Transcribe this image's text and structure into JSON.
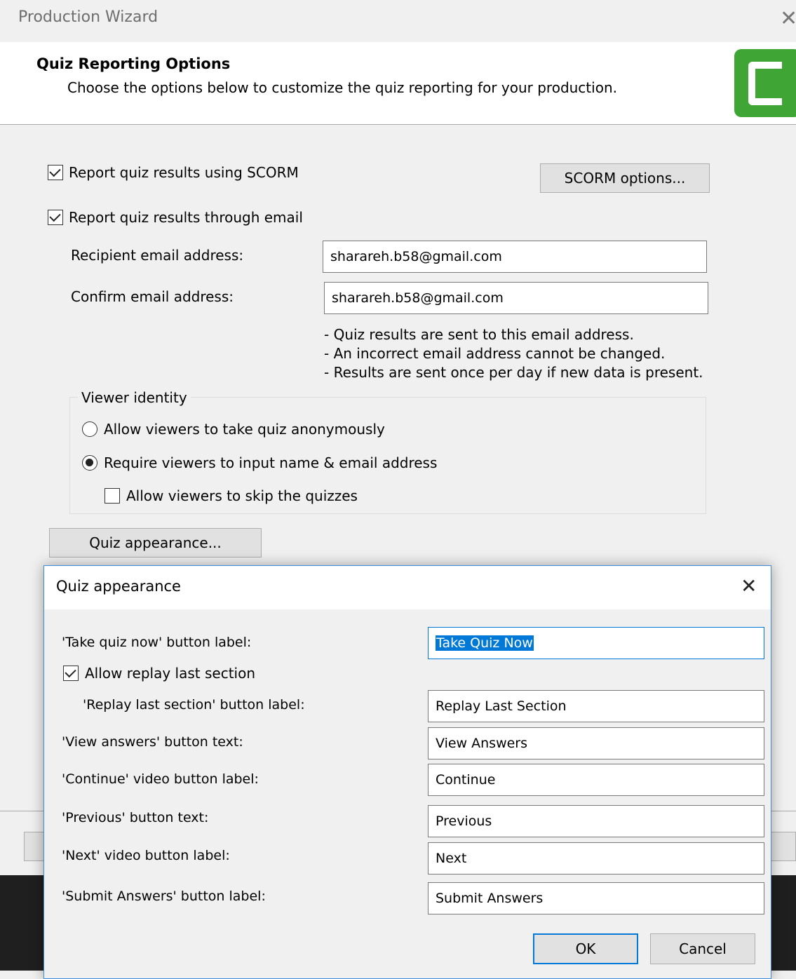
{
  "window": {
    "title": "Production Wizard",
    "close_glyph": "✕"
  },
  "header": {
    "title": "Quiz Reporting Options",
    "subtitle": "Choose the options below to customize the quiz reporting for your production.",
    "logo_icon": "camtasia-logo-icon",
    "logo_color": "#3fa535"
  },
  "reporting": {
    "scorm_checkbox_label": "Report quiz results using SCORM",
    "scorm_checked": true,
    "scorm_options_button": "SCORM options...",
    "email_checkbox_label": "Report quiz results through email",
    "email_checked": true,
    "recipient_label": "Recipient email address:",
    "recipient_value": "sharareh.b58@gmail.com",
    "confirm_label": "Confirm email address:",
    "confirm_value": "sharareh.b58@gmail.com",
    "notes": [
      "- Quiz results are sent to this email address.",
      "- An incorrect email address cannot be changed.",
      "- Results are sent once per day if new data is present."
    ]
  },
  "viewer_identity": {
    "legend": "Viewer identity",
    "anonymous_label": "Allow viewers to take quiz anonymously",
    "anonymous_selected": false,
    "require_label": "Require viewers to input name & email address",
    "require_selected": true,
    "skip_label": "Allow viewers to skip the quizzes",
    "skip_checked": false
  },
  "quiz_appearance_button": "Quiz appearance...",
  "dialog": {
    "title": "Quiz appearance",
    "close_glyph": "✕",
    "take_quiz_label": "'Take quiz now' button label:",
    "take_quiz_value": "Take Quiz Now",
    "allow_replay_label": "Allow replay last section",
    "allow_replay_checked": true,
    "replay_label": "'Replay last section' button label:",
    "replay_value": "Replay Last Section",
    "view_answers_label": "'View answers' button text:",
    "view_answers_value": "View Answers",
    "continue_label": "'Continue' video button label:",
    "continue_value": "Continue",
    "previous_label": "'Previous' button text:",
    "previous_value": "Previous",
    "next_label": "'Next' video button label:",
    "next_value": "Next",
    "submit_label": "'Submit Answers' button label:",
    "submit_value": "Submit Answers",
    "ok_button": "OK",
    "cancel_button": "Cancel",
    "accent_color": "#0078d7"
  }
}
